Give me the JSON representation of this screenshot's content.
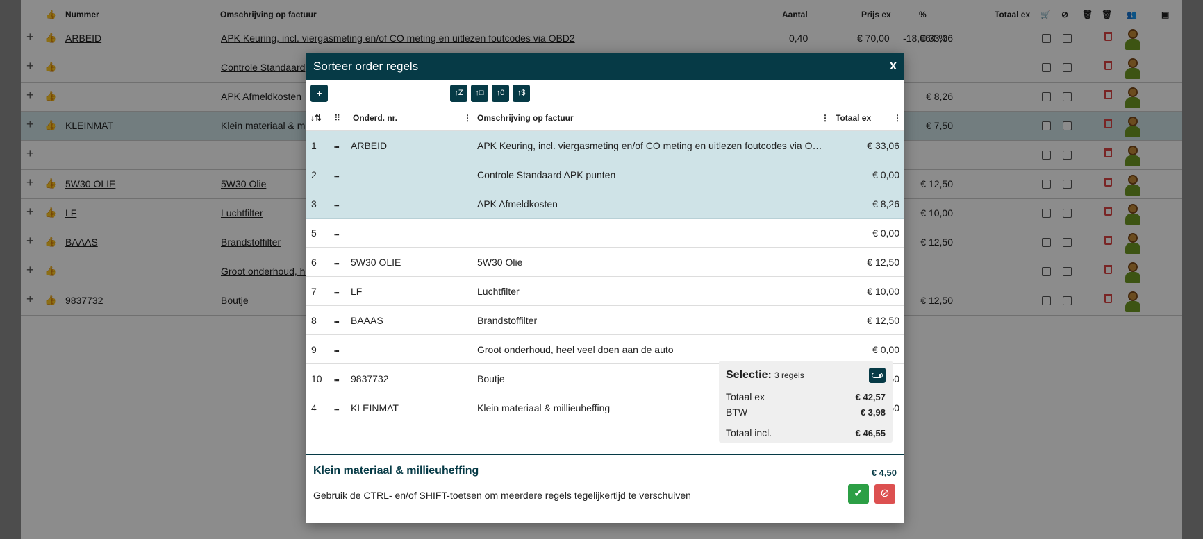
{
  "background": {
    "headers": {
      "nummer": "Nummer",
      "omschrijving": "Omschrijving op factuur",
      "aantal": "Aantal",
      "prijs": "Prijs ex",
      "pct": "%",
      "totaal": "Totaal ex"
    },
    "rows": [
      {
        "nummer": "ARBEID",
        "omschrijving": "APK Keuring, incl. viergasmeting en/of CO meting en uitlezen foutcodes via OBD2",
        "aantal": "0,40",
        "prijs": "€ 70,00",
        "pct": "-18,064 %",
        "totaal": "€ 33,06"
      },
      {
        "nummer": "",
        "omschrijving": "Controle Standaard",
        "totaal": ""
      },
      {
        "nummer": "",
        "omschrijving": "APK Afmeldkosten",
        "totaal": "€ 8,26"
      },
      {
        "nummer": "KLEINMAT",
        "omschrijving": "Klein materiaal & m",
        "totaal": "€ 7,50"
      },
      {
        "nummer": "",
        "omschrijving": "",
        "totaal": ""
      },
      {
        "nummer": "5W30 OLIE",
        "omschrijving": "5W30 Olie",
        "totaal": "€ 12,50"
      },
      {
        "nummer": "LF",
        "omschrijving": "Luchtfilter",
        "totaal": "€ 10,00"
      },
      {
        "nummer": "BAAAS",
        "omschrijving": "Brandstoffilter",
        "totaal": "€ 12,50"
      },
      {
        "nummer": "",
        "omschrijving": "Groot onderhoud, he",
        "totaal": ""
      },
      {
        "nummer": "9837732",
        "omschrijving": "Boutje",
        "totaal": "€ 12,50"
      }
    ]
  },
  "modal": {
    "title": "Sorteer order regels",
    "close": "x",
    "headers": {
      "nr": "Onderd. nr.",
      "omschrijving": "Omschrijving op factuur",
      "totaal": "Totaal ex"
    },
    "rows": [
      {
        "idx": "1",
        "nr": "ARBEID",
        "omschrijving": "APK Keuring, incl. viergasmeting en/of CO meting en uitlezen foutcodes via O…",
        "totaal": "€ 33,06",
        "selected": true
      },
      {
        "idx": "2",
        "nr": "",
        "omschrijving": "Controle Standaard APK punten",
        "totaal": "€ 0,00",
        "selected": true
      },
      {
        "idx": "3",
        "nr": "",
        "omschrijving": "APK Afmeldkosten",
        "totaal": "€ 8,26",
        "selected": true
      },
      {
        "idx": "5",
        "nr": "",
        "omschrijving": "",
        "totaal": "€ 0,00",
        "selected": false
      },
      {
        "idx": "6",
        "nr": "5W30 OLIE",
        "omschrijving": "5W30 Olie",
        "totaal": "€ 12,50",
        "selected": false
      },
      {
        "idx": "7",
        "nr": "LF",
        "omschrijving": "Luchtfilter",
        "totaal": "€ 10,00",
        "selected": false
      },
      {
        "idx": "8",
        "nr": "BAAAS",
        "omschrijving": "Brandstoffilter",
        "totaal": "€ 12,50",
        "selected": false
      },
      {
        "idx": "9",
        "nr": "",
        "omschrijving": "Groot onderhoud, heel veel doen aan de auto",
        "totaal": "€ 0,00",
        "selected": false
      },
      {
        "idx": "10",
        "nr": "9837732",
        "omschrijving": "Boutje",
        "totaal": "50",
        "selected": false
      },
      {
        "idx": "4",
        "nr": "KLEINMAT",
        "omschrijving": "Klein materiaal & millieuheffing",
        "totaal": "50",
        "selected": false
      }
    ],
    "selection": {
      "title": "Selectie:",
      "count": "3 regels",
      "totaal_ex_label": "Totaal ex",
      "totaal_ex": "€ 42,57",
      "btw_label": "BTW",
      "btw": "€ 3,98",
      "totaal_incl_label": "Totaal incl.",
      "totaal_incl": "€ 46,55"
    },
    "footer": {
      "title": "Klein materiaal & millieuheffing",
      "value": "€ 4,50",
      "hint": "Gebruik de CTRL- en/of SHIFT-toetsen om meerdere regels tegelijkertijd te verschuiven"
    }
  }
}
